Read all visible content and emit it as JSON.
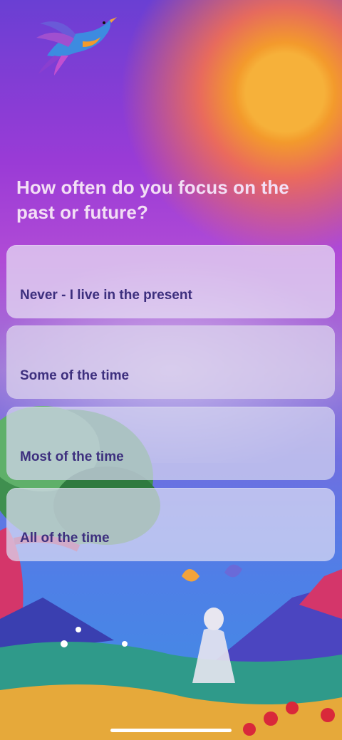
{
  "question": {
    "text": "How often do you focus on the past or future?"
  },
  "options": [
    {
      "label": "Never - I live in the present"
    },
    {
      "label": "Some of the time"
    },
    {
      "label": "Most of the time"
    },
    {
      "label": "All of the time"
    }
  ],
  "icons": {
    "illustration": "bird-illustration",
    "tree": "tree-illustration",
    "landscape": "meadow-landscape"
  },
  "colors": {
    "option_text": "#3d2f7e",
    "question_text": "#f3dff5",
    "sun": "#f6b13a"
  }
}
